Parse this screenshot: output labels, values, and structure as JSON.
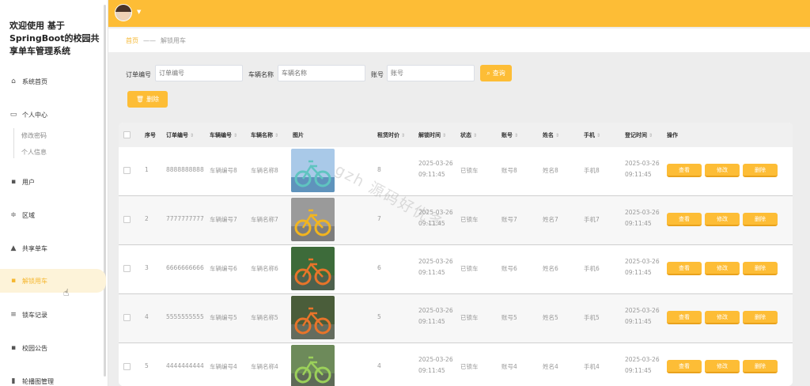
{
  "app": {
    "title": "欢迎使用 基于SpringBoot的校园共享单车管理系统"
  },
  "sidebar": {
    "items": [
      {
        "label": "系统首页",
        "icon": "home-icon"
      },
      {
        "label": "个人中心",
        "icon": "profile-icon"
      },
      {
        "label": "用户",
        "icon": "grid-icon"
      },
      {
        "label": "区域",
        "icon": "sliders-icon"
      },
      {
        "label": "共享单车",
        "icon": "thumb-icon"
      },
      {
        "label": "解锁用车",
        "icon": "grid-icon"
      },
      {
        "label": "锁车记录",
        "icon": "list-icon"
      },
      {
        "label": "校园公告",
        "icon": "grid-icon"
      },
      {
        "label": "轮播图管理",
        "icon": "chart-icon"
      }
    ],
    "sub_items": [
      {
        "label": "修改密码"
      },
      {
        "label": "个人信息"
      }
    ],
    "active": "解锁用车"
  },
  "breadcrumb": {
    "home": "首页",
    "separator": "——",
    "current": "解锁用车"
  },
  "search": {
    "order_label": "订单编号",
    "order_placeholder": "订单编号",
    "bike_label": "车辆名称",
    "bike_placeholder": "车辆名称",
    "account_label": "账号",
    "account_placeholder": "账号",
    "query_button": "查询"
  },
  "toolbar": {
    "delete_button": "删除"
  },
  "table": {
    "columns": [
      "序号",
      "订单编号",
      "车辆编号",
      "车辆名称",
      "图片",
      "租赁时价",
      "解锁时间",
      "状态",
      "账号",
      "姓名",
      "手机",
      "登记时间",
      "操作"
    ],
    "rows": [
      {
        "index": "1",
        "order": "8888888888",
        "bike_no": "车辆编号8",
        "bike_name": "车辆名称8",
        "price": "8",
        "unlock_time": "2025-03-26 09:11:45",
        "status": "已锁车",
        "account": "账号8",
        "name": "姓名8",
        "phone": "手机8",
        "reg_time": "2025-03-26 09:11:45"
      },
      {
        "index": "2",
        "order": "7777777777",
        "bike_no": "车辆编号7",
        "bike_name": "车辆名称7",
        "price": "7",
        "unlock_time": "2025-03-26 09:11:45",
        "status": "已锁车",
        "account": "账号7",
        "name": "姓名7",
        "phone": "手机7",
        "reg_time": "2025-03-26 09:11:45"
      },
      {
        "index": "3",
        "order": "6666666666",
        "bike_no": "车辆编号6",
        "bike_name": "车辆名称6",
        "price": "6",
        "unlock_time": "2025-03-26 09:11:45",
        "status": "已锁车",
        "account": "账号6",
        "name": "姓名6",
        "phone": "手机6",
        "reg_time": "2025-03-26 09:11:45"
      },
      {
        "index": "4",
        "order": "5555555555",
        "bike_no": "车辆编号5",
        "bike_name": "车辆名称5",
        "price": "5",
        "unlock_time": "2025-03-26 09:11:45",
        "status": "已锁车",
        "account": "账号5",
        "name": "姓名5",
        "phone": "手机5",
        "reg_time": "2025-03-26 09:11:45"
      },
      {
        "index": "5",
        "order": "4444444444",
        "bike_no": "车辆编号4",
        "bike_name": "车辆名称4",
        "price": "4",
        "unlock_time": "2025-03-26 09:11:45",
        "status": "已锁车",
        "account": "账号4",
        "name": "姓名4",
        "phone": "手机4",
        "reg_time": "2025-03-26 09:11:45"
      }
    ],
    "actions": {
      "view": "查看",
      "edit": "修改",
      "delete": "删除"
    }
  },
  "watermark": "gzh 源码好优多",
  "colors": {
    "accent": "#fdbd36",
    "active_bg": "#fdf3d9"
  }
}
